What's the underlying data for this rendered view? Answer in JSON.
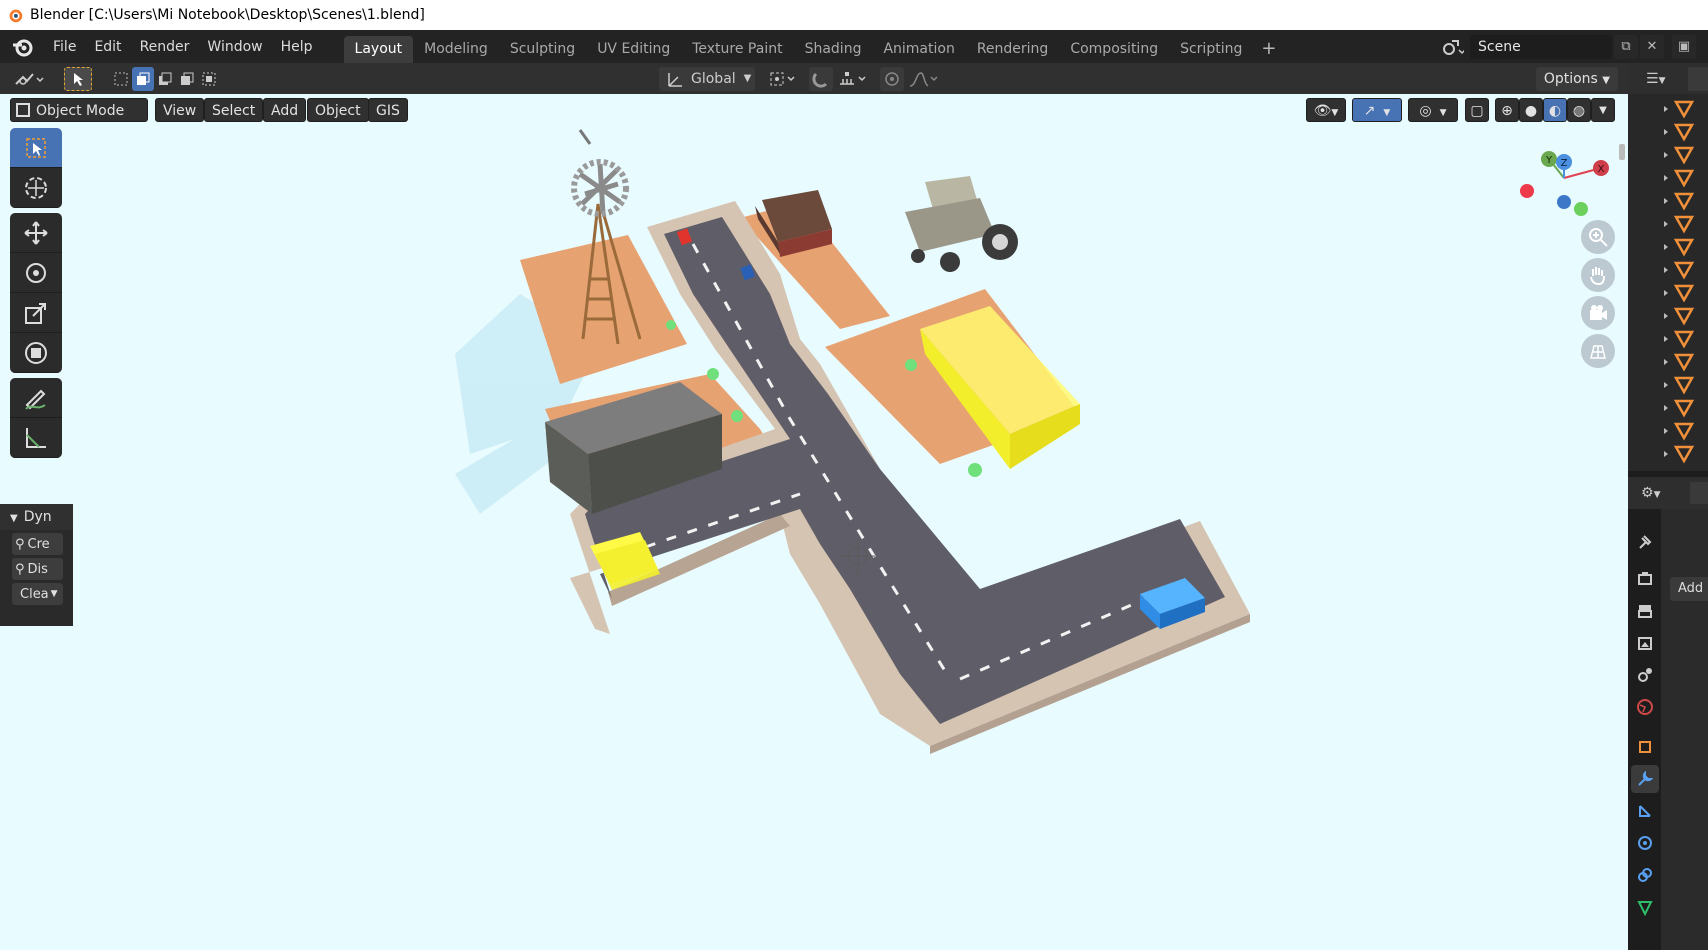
{
  "window": {
    "title": "Blender [C:\\Users\\Mi Notebook\\Desktop\\Scenes\\1.blend]"
  },
  "menu": [
    "File",
    "Edit",
    "Render",
    "Window",
    "Help"
  ],
  "workspaces": {
    "tabs": [
      "Layout",
      "Modeling",
      "Sculpting",
      "UV Editing",
      "Texture Paint",
      "Shading",
      "Animation",
      "Rendering",
      "Compositing",
      "Scripting"
    ],
    "active": "Layout",
    "add_symbol": "+"
  },
  "scene": {
    "name": "Scene"
  },
  "tool_header": {
    "orientation": "Global",
    "options_label": "Options"
  },
  "viewport_header": {
    "mode": "Object Mode",
    "menus": [
      "View",
      "Select",
      "Add",
      "Object",
      "GIS"
    ]
  },
  "tools": [
    "select-box",
    "cursor",
    "move",
    "rotate",
    "scale",
    "transform",
    "annotate",
    "measure"
  ],
  "dyn_panel": {
    "title": "Dyn",
    "rows": [
      "Cre",
      "Dis",
      "Clea"
    ]
  },
  "gizmo": {
    "axes": [
      "X",
      "Y",
      "Z"
    ],
    "colors": {
      "x": "#e0434f",
      "y": "#6aa84f",
      "z": "#4a8fe0"
    }
  },
  "properties": {
    "add_label": "Add",
    "active_tab": "modifiers"
  },
  "colors": {
    "accent": "#4772b3",
    "sky": "#e8fbff",
    "road": "#5f5e66",
    "sidewalk": "#d9c6b4",
    "lot": "#eaa877",
    "selected": "#f3f036",
    "blue_box": "#2f8de6"
  }
}
